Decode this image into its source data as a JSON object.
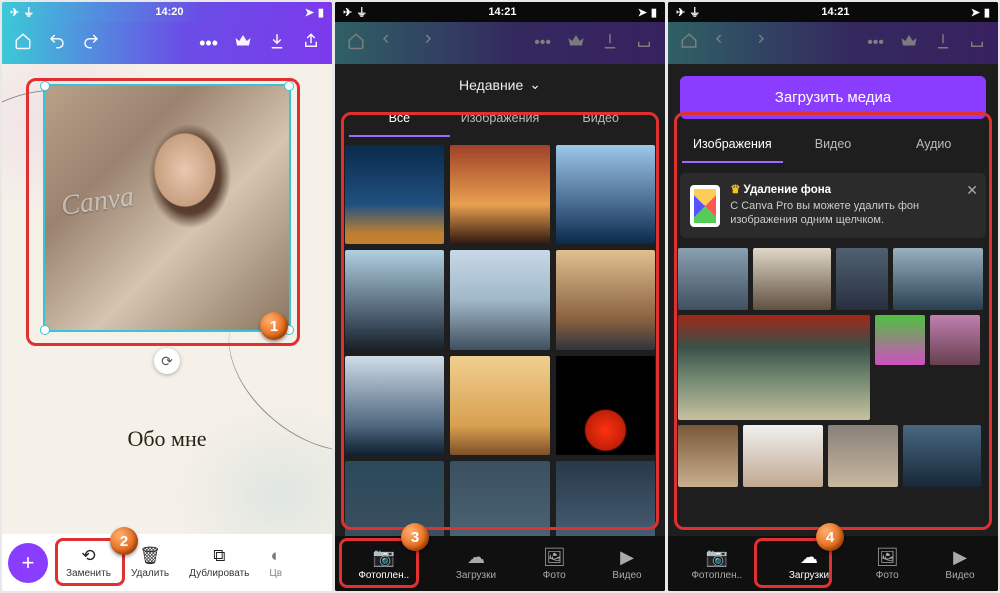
{
  "panel1": {
    "status": {
      "airplane": "✈",
      "wifi": "⏚",
      "time": "14:20",
      "send": "➤",
      "battery": "▮"
    },
    "canvas": {
      "watermark": "Canva",
      "caption": "Обо мне"
    },
    "markers": {
      "m1": "1",
      "m2": "2"
    },
    "tools": {
      "replace": "Заменить",
      "delete": "Удалить",
      "duplicate": "Дублировать",
      "color_cut": "Цв"
    }
  },
  "panel2": {
    "status": {
      "time": "14:21"
    },
    "sheet_title": "Недавние",
    "tabs": {
      "all": "Все",
      "images": "Изображения",
      "video": "Видео"
    },
    "nav": {
      "camera": "Фотоплен..",
      "uploads": "Загрузки",
      "photo": "Фото",
      "video": "Видео"
    },
    "marker": "3"
  },
  "panel3": {
    "status": {
      "time": "14:21"
    },
    "upload_label": "Загрузить медиа",
    "tabs": {
      "images": "Изображения",
      "video": "Видео",
      "audio": "Аудио"
    },
    "promo": {
      "title": "Удаление фона",
      "desc": "С Canva Pro вы можете удалить фон изображения одним щелчком."
    },
    "nav": {
      "camera": "Фотоплен..",
      "uploads": "Загрузки",
      "photo": "Фото",
      "video": "Видео"
    },
    "marker": "4"
  }
}
